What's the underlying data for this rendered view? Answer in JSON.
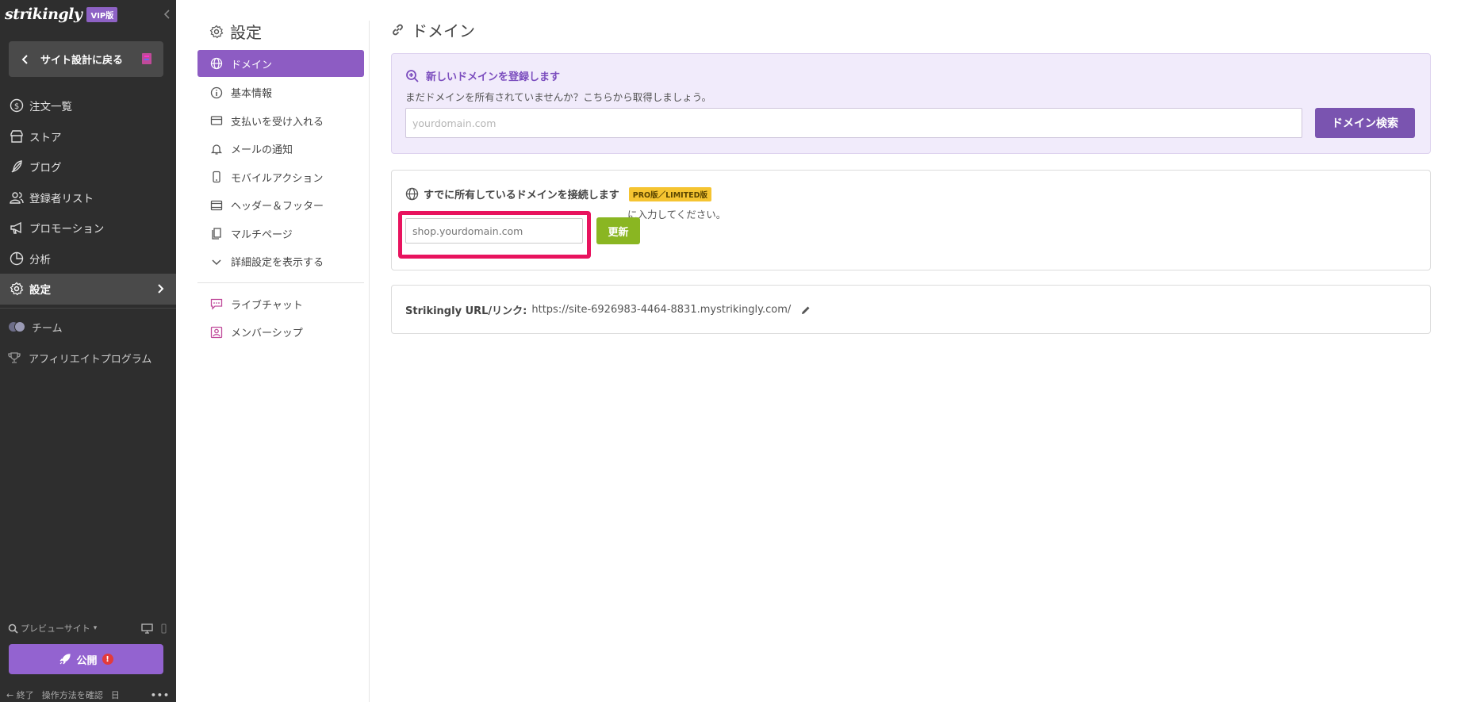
{
  "brand": {
    "logo": "strikingly",
    "badge": "VIP版"
  },
  "sidebar": {
    "back_label": "サイト設計に戻る",
    "nav": [
      {
        "label": "注文一覧",
        "icon": "dollar-circle-icon"
      },
      {
        "label": "ストア",
        "icon": "store-icon"
      },
      {
        "label": "ブログ",
        "icon": "feather-icon"
      },
      {
        "label": "登録者リスト",
        "icon": "users-icon"
      },
      {
        "label": "プロモーション",
        "icon": "megaphone-icon"
      },
      {
        "label": "分析",
        "icon": "pie-chart-icon"
      },
      {
        "label": "設定",
        "icon": "gear-icon",
        "active": true
      }
    ],
    "secondary": [
      {
        "label": "チーム",
        "icon": "team-avatars-icon"
      },
      {
        "label": "アフィリエイトプログラム",
        "icon": "trophy-icon"
      }
    ],
    "preview_label": "プレビューサイト",
    "publish_label": "公開",
    "publish_alert": "!",
    "footer": {
      "exit": "終了",
      "help": "操作方法を確認",
      "lang": "日",
      "more": "•••"
    }
  },
  "settings": {
    "title": "設定",
    "menu": [
      {
        "label": "ドメイン",
        "icon": "globe-icon",
        "active": true
      },
      {
        "label": "基本情報",
        "icon": "info-icon"
      },
      {
        "label": "支払いを受け入れる",
        "icon": "payment-icon"
      },
      {
        "label": "メールの通知",
        "icon": "bell-icon"
      },
      {
        "label": "モバイルアクション",
        "icon": "mobile-icon"
      },
      {
        "label": "ヘッダー＆フッター",
        "icon": "layout-icon"
      },
      {
        "label": "マルチページ",
        "icon": "pages-icon"
      },
      {
        "label": "詳細設定を表示する",
        "icon": "chevron-down-icon"
      }
    ],
    "extras": [
      {
        "label": "ライブチャット",
        "icon": "chat-icon"
      },
      {
        "label": "メンバーシップ",
        "icon": "member-icon"
      }
    ]
  },
  "domain": {
    "title": "ドメイン",
    "register": {
      "title": "新しいドメインを登録します",
      "subtitle": "まだドメインを所有されていませんか？こちらから取得しましょう。",
      "placeholder": "yourdomain.com",
      "button": "ドメイン検索"
    },
    "connect": {
      "title": "すでに所有しているドメインを接続します",
      "badge": "PRO版／LIMITED版",
      "subtitle_visible": "に入力してください。",
      "placeholder": "shop.yourdomain.com",
      "button": "更新"
    },
    "url": {
      "label": "Strikingly URL/リンク:",
      "value": "https://site-6926983-4464-8831.mystrikingly.com/"
    }
  },
  "colors": {
    "sidebar_bg": "#2e2e2e",
    "accent_purple": "#8d5cc3",
    "update_green": "#8ab622",
    "highlight": "#e8135e",
    "badge_yellow": "#f5c431"
  }
}
